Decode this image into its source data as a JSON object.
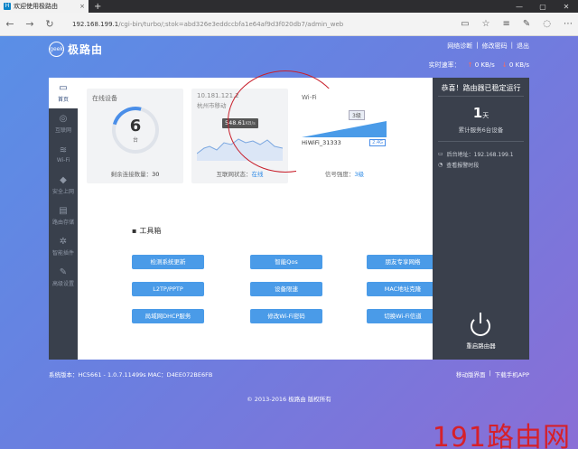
{
  "browser": {
    "tab_title": "欢迎使用极路由",
    "url_host": "192.168.199.1",
    "url_rest": "/cgi-bin/turbo/;stok=abd326e3eddccbfa1e64af9d3f020db7/admin_web",
    "new_tab": "+",
    "tab_close": "×"
  },
  "header": {
    "logo_badge": "geek",
    "logo_text": "极路由",
    "links": [
      "网络诊断",
      "修改密码",
      "退出"
    ],
    "speed_label": "实时速率：",
    "upload": "0 KB/s",
    "download": "0 KB/s",
    "up_arrow": "↑",
    "down_arrow": "↓"
  },
  "sidebar": {
    "items": [
      {
        "label": "首页",
        "glyph": "▭"
      },
      {
        "label": "互联网",
        "glyph": "◎"
      },
      {
        "label": "Wi-Fi",
        "glyph": "≋"
      },
      {
        "label": "安全上网",
        "glyph": "◆"
      },
      {
        "label": "路由存储",
        "glyph": "▤"
      },
      {
        "label": "智能插件",
        "glyph": "✲"
      },
      {
        "label": "高级设置",
        "glyph": "✎"
      }
    ]
  },
  "cards": {
    "devices": {
      "label": "在线设备",
      "count": "6",
      "unit": "台",
      "foot_label": "剩余连接数量：",
      "foot_value": "30"
    },
    "internet": {
      "ip": "10.181.121.2",
      "isp": "杭州市移动",
      "speed": "548.61",
      "speed_unit": "KB/s",
      "foot_label": "互联网状态：",
      "foot_value": "在线"
    },
    "wifi": {
      "label": "Wi-Fi",
      "level": "3级",
      "ssid": "HiWiFi_31333",
      "band": "2.4G",
      "foot_label": "信号强度：",
      "foot_value": "3级"
    }
  },
  "tools": {
    "title": "工具箱",
    "title_icon": "▪",
    "buttons": [
      "检测系统更新",
      "智能Qos",
      "朋友专享网络",
      "L2TP/PPTP",
      "设备限速",
      "MAC地址克隆",
      "局域网DHCP服务",
      "修改Wi-Fi密码",
      "切换Wi-Fi信道"
    ]
  },
  "right_panel": {
    "title": "恭喜！路由器已稳定运行",
    "days": "1",
    "days_unit": "天",
    "sub": "累计服务6台设备",
    "backend_label": "后台地址：192.168.199.1",
    "alert_label": "查看报警时段",
    "power_label": "重启路由器"
  },
  "footer": {
    "version": "系统版本：HC5661 - 1.0.7.11499s    MAC：D4EE072BE6FB",
    "links": [
      "移动版界面",
      "|",
      "下载手机APP"
    ],
    "copyright": "© 2013-2016 极路由 版权所有"
  },
  "watermark": "191路由网",
  "colors": {
    "accent": "#4a9be8",
    "dark": "#3a404c",
    "alert": "#c8202c"
  }
}
